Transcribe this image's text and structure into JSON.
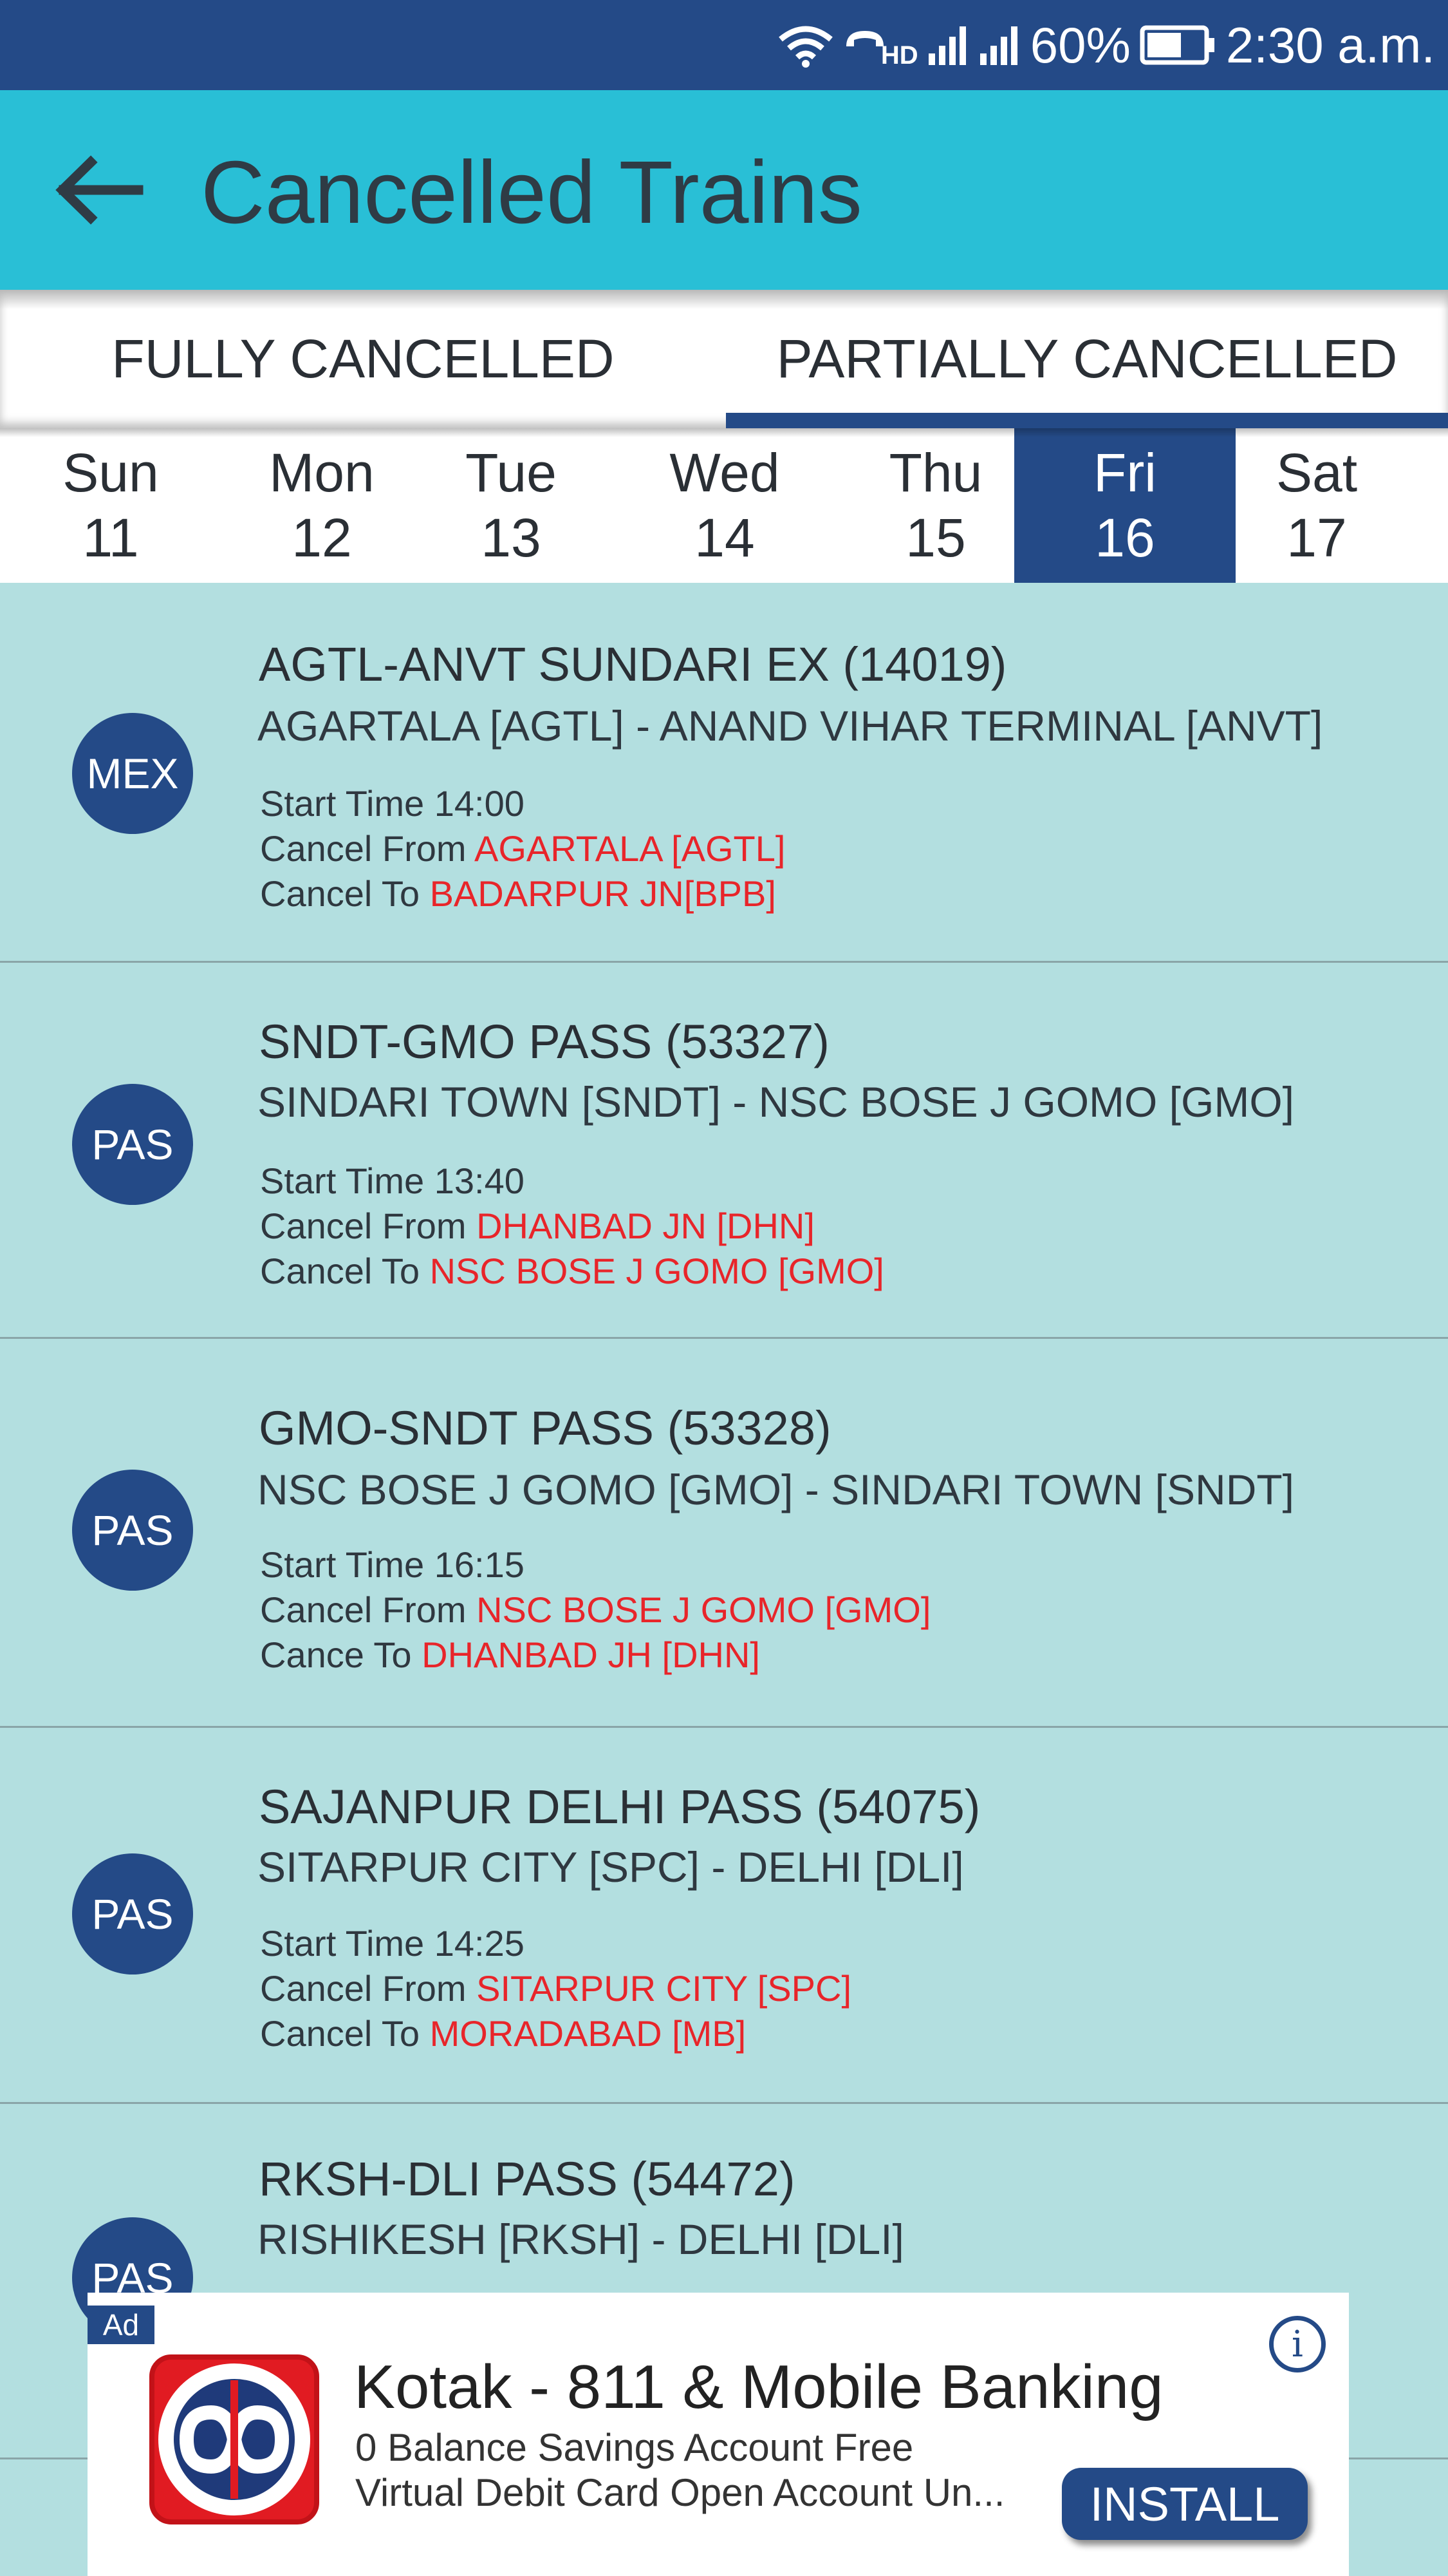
{
  "status_bar": {
    "battery": "60%",
    "time": "2:30 a.m.",
    "hd": "HD",
    "icons": [
      "wifi-icon",
      "hd-call-icon",
      "signal-icon",
      "signal-icon",
      "battery-icon"
    ]
  },
  "header": {
    "title": "Cancelled Trains",
    "back_icon": "arrow-left-icon"
  },
  "tabs": [
    {
      "label": "FULLY CANCELLED",
      "selected": false
    },
    {
      "label": "PARTIALLY CANCELLED",
      "selected": true
    }
  ],
  "days": [
    {
      "day": "Sun",
      "date": "11",
      "selected": false
    },
    {
      "day": "Mon",
      "date": "12",
      "selected": false
    },
    {
      "day": "Tue",
      "date": "13",
      "selected": false
    },
    {
      "day": "Wed",
      "date": "14",
      "selected": false
    },
    {
      "day": "Thu",
      "date": "15",
      "selected": false
    },
    {
      "day": "Fri",
      "date": "16",
      "selected": true
    },
    {
      "day": "Sat",
      "date": "17",
      "selected": false
    }
  ],
  "trains": [
    {
      "badge": "MEX",
      "name": "AGTL-ANVT SUNDARI EX (14019)",
      "route": "AGARTALA [AGTL] - ANAND VIHAR TERMINAL [ANVT]",
      "start_label": "Start Time ",
      "start_time": "14:00",
      "from_label": "Cancel From ",
      "from_value": "AGARTALA [AGTL]",
      "to_label": "Cancel To ",
      "to_value": "BADARPUR JN[BPB]"
    },
    {
      "badge": "PAS",
      "name": "SNDT-GMO PASS (53327)",
      "route": "SINDARI TOWN [SNDT] - NSC BOSE J GOMO [GMO]",
      "start_label": "Start Time ",
      "start_time": "13:40",
      "from_label": "Cancel From ",
      "from_value": "DHANBAD JN [DHN]",
      "to_label": "Cancel To ",
      "to_value": "NSC BOSE J GOMO [GMO]"
    },
    {
      "badge": "PAS",
      "name": "GMO-SNDT PASS (53328)",
      "route": "NSC BOSE J GOMO [GMO] - SINDARI TOWN [SNDT]",
      "start_label": "Start Time ",
      "start_time": "16:15",
      "from_label": "Cancel From ",
      "from_value": "NSC BOSE J GOMO [GMO]",
      "to_label": "Cance To ",
      "to_value": "DHANBAD JH [DHN]"
    },
    {
      "badge": "PAS",
      "name": "SAJANPUR DELHI PASS (54075)",
      "route": "SITARPUR CITY [SPC] - DELHI [DLI]",
      "start_label": "Start Time ",
      "start_time": "14:25",
      "from_label": "Cancel From ",
      "from_value": "SITARPUR CITY [SPC]",
      "to_label": "Cancel To ",
      "to_value": "MORADABAD [MB]"
    },
    {
      "badge": "PAS",
      "name": "RKSH-DLI PASS (54472)",
      "route": "RISHIKESH [RKSH] - DELHI [DLI]"
    }
  ],
  "ad": {
    "tag": "Ad",
    "info_icon": "info-icon",
    "title": "Kotak - 811 & Mobile Banking",
    "line1": "0 Balance Savings Account Free",
    "line2": "Virtual Debit Card  Open Account Un...",
    "install_label": "INSTALL",
    "logo_icon": "kotak-logo-icon"
  },
  "colors": {
    "status_bar": "#244a87",
    "header": "#29bfd6",
    "list_bg": "#b3dfe0",
    "accent": "#244a87",
    "red": "#e8252a"
  }
}
